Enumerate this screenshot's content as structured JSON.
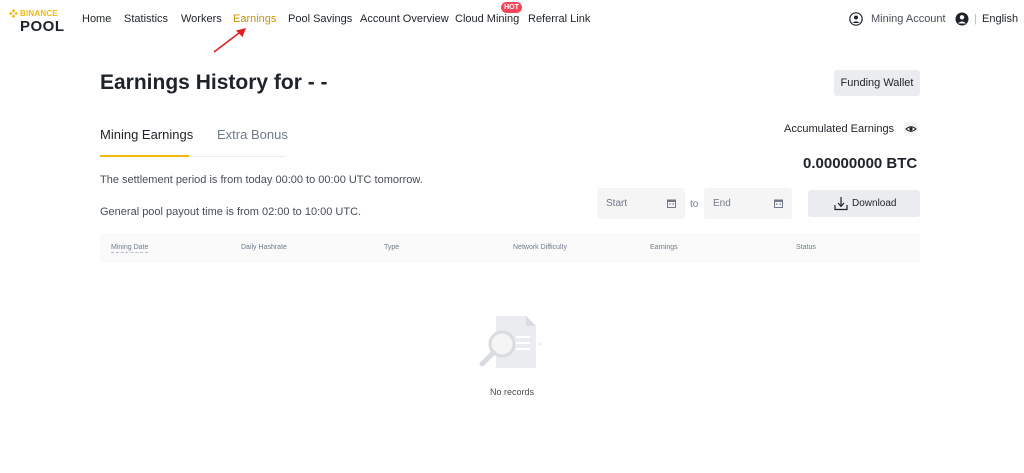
{
  "brand": {
    "small": "BINANCE",
    "big": "POOL"
  },
  "nav": {
    "items": [
      "Home",
      "Statistics",
      "Workers",
      "Earnings",
      "Pool Savings",
      "Account Overview",
      "Cloud Mining",
      "Referral Link"
    ],
    "active": "Earnings",
    "hot_badge": "HOT",
    "account_label": "Mining Account",
    "language": "English",
    "separator": "|"
  },
  "header": {
    "title": "Earnings History for - -",
    "funding_button": "Funding Wallet"
  },
  "tabs": [
    "Mining Earnings",
    "Extra Bonus"
  ],
  "accumulated": {
    "label": "Accumulated Earnings",
    "value": "0.00000000 BTC"
  },
  "info": {
    "settlement": "The settlement period is from today 00:00 to 00:00 UTC tomorrow.",
    "payout": "General pool payout time is from 02:00 to 10:00 UTC."
  },
  "date_range": {
    "start_placeholder": "Start",
    "to": "to",
    "end_placeholder": "End"
  },
  "download_label": "Download",
  "table": {
    "columns": [
      "Mining Date",
      "Daily Hashrate",
      "Type",
      "Network Difficulty",
      "Earnings",
      "Status"
    ]
  },
  "empty_state": {
    "label": "No records"
  },
  "colors": {
    "accent": "#f0b90b",
    "active_text": "#c99400",
    "hot": "#f6465d",
    "annotation_arrow": "#e02020"
  }
}
